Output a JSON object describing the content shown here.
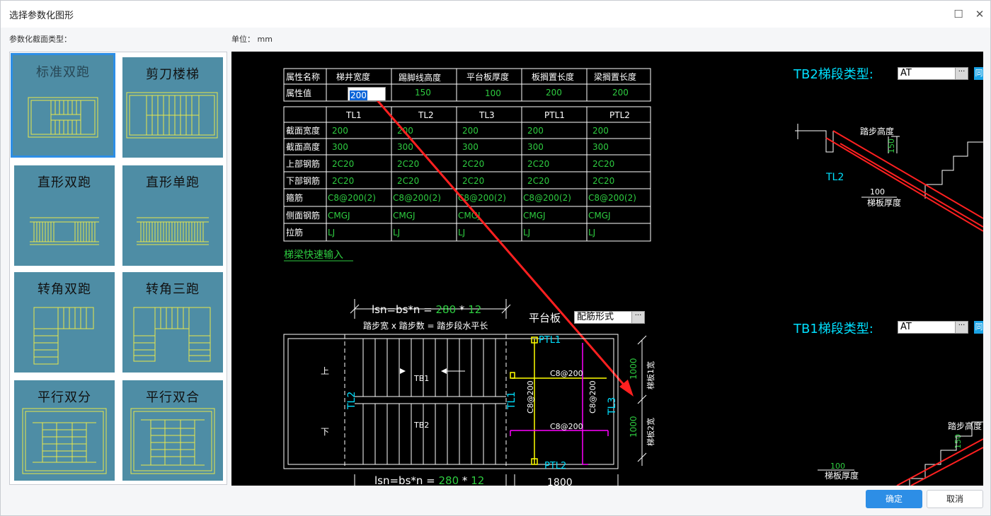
{
  "window": {
    "title": "选择参数化图形",
    "maximize_icon": "maximize-icon",
    "close_icon": "close-icon"
  },
  "labels": {
    "section_type": "参数化截面类型：",
    "unit": "单位： mm"
  },
  "tiles": [
    {
      "name": "标准双跑"
    },
    {
      "name": "剪刀楼梯"
    },
    {
      "name": "直形双跑"
    },
    {
      "name": "直形单跑"
    },
    {
      "name": "转角双跑"
    },
    {
      "name": "转角三跑"
    },
    {
      "name": "平行双分"
    },
    {
      "name": "平行双合"
    }
  ],
  "attr_table": {
    "headers": [
      "属性名称",
      "梯井宽度",
      "踢脚线高度",
      "平台板厚度",
      "板搁置长度",
      "梁搁置长度"
    ],
    "row_label": "属性值",
    "values": [
      "200",
      "150",
      "100",
      "200",
      "200"
    ]
  },
  "beam_table": {
    "columns": [
      "TL1",
      "TL2",
      "TL3",
      "PTL1",
      "PTL2"
    ],
    "rows": [
      {
        "label": "截面宽度",
        "cells": [
          "200",
          "200",
          "200",
          "200",
          "200"
        ]
      },
      {
        "label": "截面高度",
        "cells": [
          "300",
          "300",
          "300",
          "300",
          "300"
        ]
      },
      {
        "label": "上部钢筋",
        "cells": [
          "2C20",
          "2C20",
          "2C20",
          "2C20",
          "2C20"
        ]
      },
      {
        "label": "下部钢筋",
        "cells": [
          "2C20",
          "2C20",
          "2C20",
          "2C20",
          "2C20"
        ]
      },
      {
        "label": "箍筋",
        "cells": [
          "C8@200(2)",
          "C8@200(2)",
          "C8@200(2)",
          "C8@200(2)",
          "C8@200(2)"
        ]
      },
      {
        "label": "侧面钢筋",
        "cells": [
          "CMGJ",
          "CMGJ",
          "CMGJ",
          "CMGJ",
          "CMGJ"
        ]
      },
      {
        "label": "拉筋",
        "cells": [
          "LJ",
          "LJ",
          "LJ",
          "LJ",
          "LJ"
        ]
      }
    ]
  },
  "quick_input": "梯梁快速输入",
  "plan": {
    "formula_prefix": "lsn=bs*n = ",
    "bs": "280",
    "star": " * ",
    "n": "12",
    "formula_note": "踏步宽 x 踏步数 = 踏步段水平长",
    "platform_label": "平台板",
    "platform_value": "配筋形式",
    "up": "上",
    "down": "下",
    "tb1": "TB1",
    "tb2": "TB2",
    "tl1": "TL1",
    "tl2": "TL2",
    "tl3": "TL3",
    "ptl1": "PTL1",
    "ptl2": "PTL2",
    "rebar": "C8@200",
    "dim1": "1000",
    "dim2": "1000",
    "w1": "梯板1宽",
    "w2": "梯板2宽",
    "bottom_width": "1800"
  },
  "tb2_section": {
    "label": "TB2梯段类型:",
    "value": "AT",
    "btn": "同",
    "step_height": "踏步高度",
    "h": "150",
    "thickness": "梯板厚度",
    "t": "100",
    "tl2": "TL2"
  },
  "tb1_section": {
    "label": "TB1梯段类型:",
    "value": "AT",
    "btn": "同",
    "step_height": "踏步高度",
    "h": "150",
    "thickness": "梯板厚度",
    "t": "100"
  },
  "buttons": {
    "ok": "确定",
    "cancel": "取消"
  },
  "colors": {
    "accent": "#2d8ee6",
    "tile": "#4e8da5",
    "cad_bg": "#000000",
    "green": "#2ecc40",
    "yellow": "#ffff00",
    "cyan": "#00e0ff",
    "magenta": "#ff00ff",
    "red": "#ff2020"
  }
}
